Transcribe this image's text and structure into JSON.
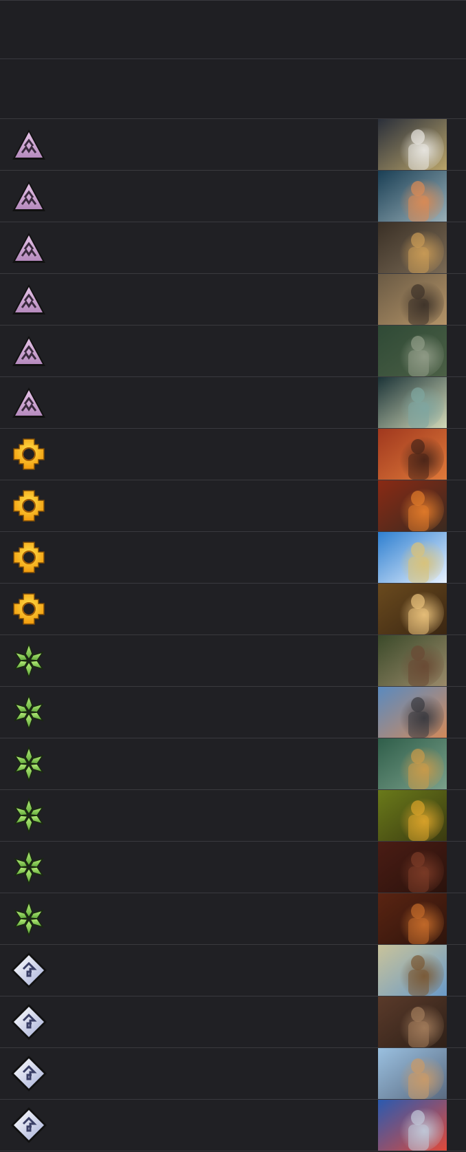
{
  "rows": [
    {
      "faction": "dark-triangle-icon",
      "art": {
        "bg": "#2a2f3a",
        "fg": "#e8e6e0",
        "accent": "#b9a46a"
      }
    },
    {
      "faction": "dark-triangle-icon",
      "art": {
        "bg": "#1a3f55",
        "fg": "#d88a55",
        "accent": "#9ab0b8"
      }
    },
    {
      "faction": "dark-triangle-icon",
      "art": {
        "bg": "#3a3026",
        "fg": "#c89a56",
        "accent": "#7a6a55"
      }
    },
    {
      "faction": "dark-triangle-icon",
      "art": {
        "bg": "#6a5a44",
        "fg": "#3e3329",
        "accent": "#b49468"
      }
    },
    {
      "faction": "dark-triangle-icon",
      "art": {
        "bg": "#2f4a36",
        "fg": "#8f9b86",
        "accent": "#4b5f45"
      }
    },
    {
      "faction": "dark-triangle-icon",
      "art": {
        "bg": "#1c3438",
        "fg": "#7fa6a0",
        "accent": "#d3d9b8"
      }
    },
    {
      "faction": "sun-gear-icon",
      "art": {
        "bg": "#a0381e",
        "fg": "#4a2518",
        "accent": "#e07a3a"
      }
    },
    {
      "faction": "sun-gear-icon",
      "art": {
        "bg": "#8a2a14",
        "fg": "#e07a2a",
        "accent": "#3a2a20"
      }
    },
    {
      "faction": "sun-gear-icon",
      "art": {
        "bg": "#2e7fd0",
        "fg": "#d8c27a",
        "accent": "#e8f2ff"
      }
    },
    {
      "faction": "sun-gear-icon",
      "art": {
        "bg": "#6a4a1e",
        "fg": "#e8c07a",
        "accent": "#3a2612"
      }
    },
    {
      "faction": "green-leaf-icon",
      "art": {
        "bg": "#3b4a2a",
        "fg": "#6a4a34",
        "accent": "#9a8a6a"
      }
    },
    {
      "faction": "green-leaf-icon",
      "art": {
        "bg": "#5a8abf",
        "fg": "#3b3b40",
        "accent": "#d28a5a"
      }
    },
    {
      "faction": "green-leaf-icon",
      "art": {
        "bg": "#2f5e4a",
        "fg": "#c89a4a",
        "accent": "#7aa08a"
      }
    },
    {
      "faction": "green-leaf-icon",
      "art": {
        "bg": "#6a7a1a",
        "fg": "#d8a22a",
        "accent": "#3a3a10"
      }
    },
    {
      "faction": "green-leaf-icon",
      "art": {
        "bg": "#4a1c14",
        "fg": "#7a3a26",
        "accent": "#2a120c"
      }
    },
    {
      "faction": "green-leaf-icon",
      "art": {
        "bg": "#5a2412",
        "fg": "#c26a2a",
        "accent": "#2e140c"
      }
    },
    {
      "faction": "silver-diamond-icon",
      "art": {
        "bg": "#c9c39a",
        "fg": "#7a5a36",
        "accent": "#6a9ac8"
      }
    },
    {
      "faction": "silver-diamond-icon",
      "art": {
        "bg": "#5a3a2a",
        "fg": "#a07a5a",
        "accent": "#2e2018"
      }
    },
    {
      "faction": "silver-diamond-icon",
      "art": {
        "bg": "#9ac0e0",
        "fg": "#c89a6a",
        "accent": "#5a6a80"
      }
    },
    {
      "faction": "silver-diamond-icon",
      "art": {
        "bg": "#2a5ab0",
        "fg": "#c0c8d8",
        "accent": "#e04a3a"
      }
    }
  ]
}
